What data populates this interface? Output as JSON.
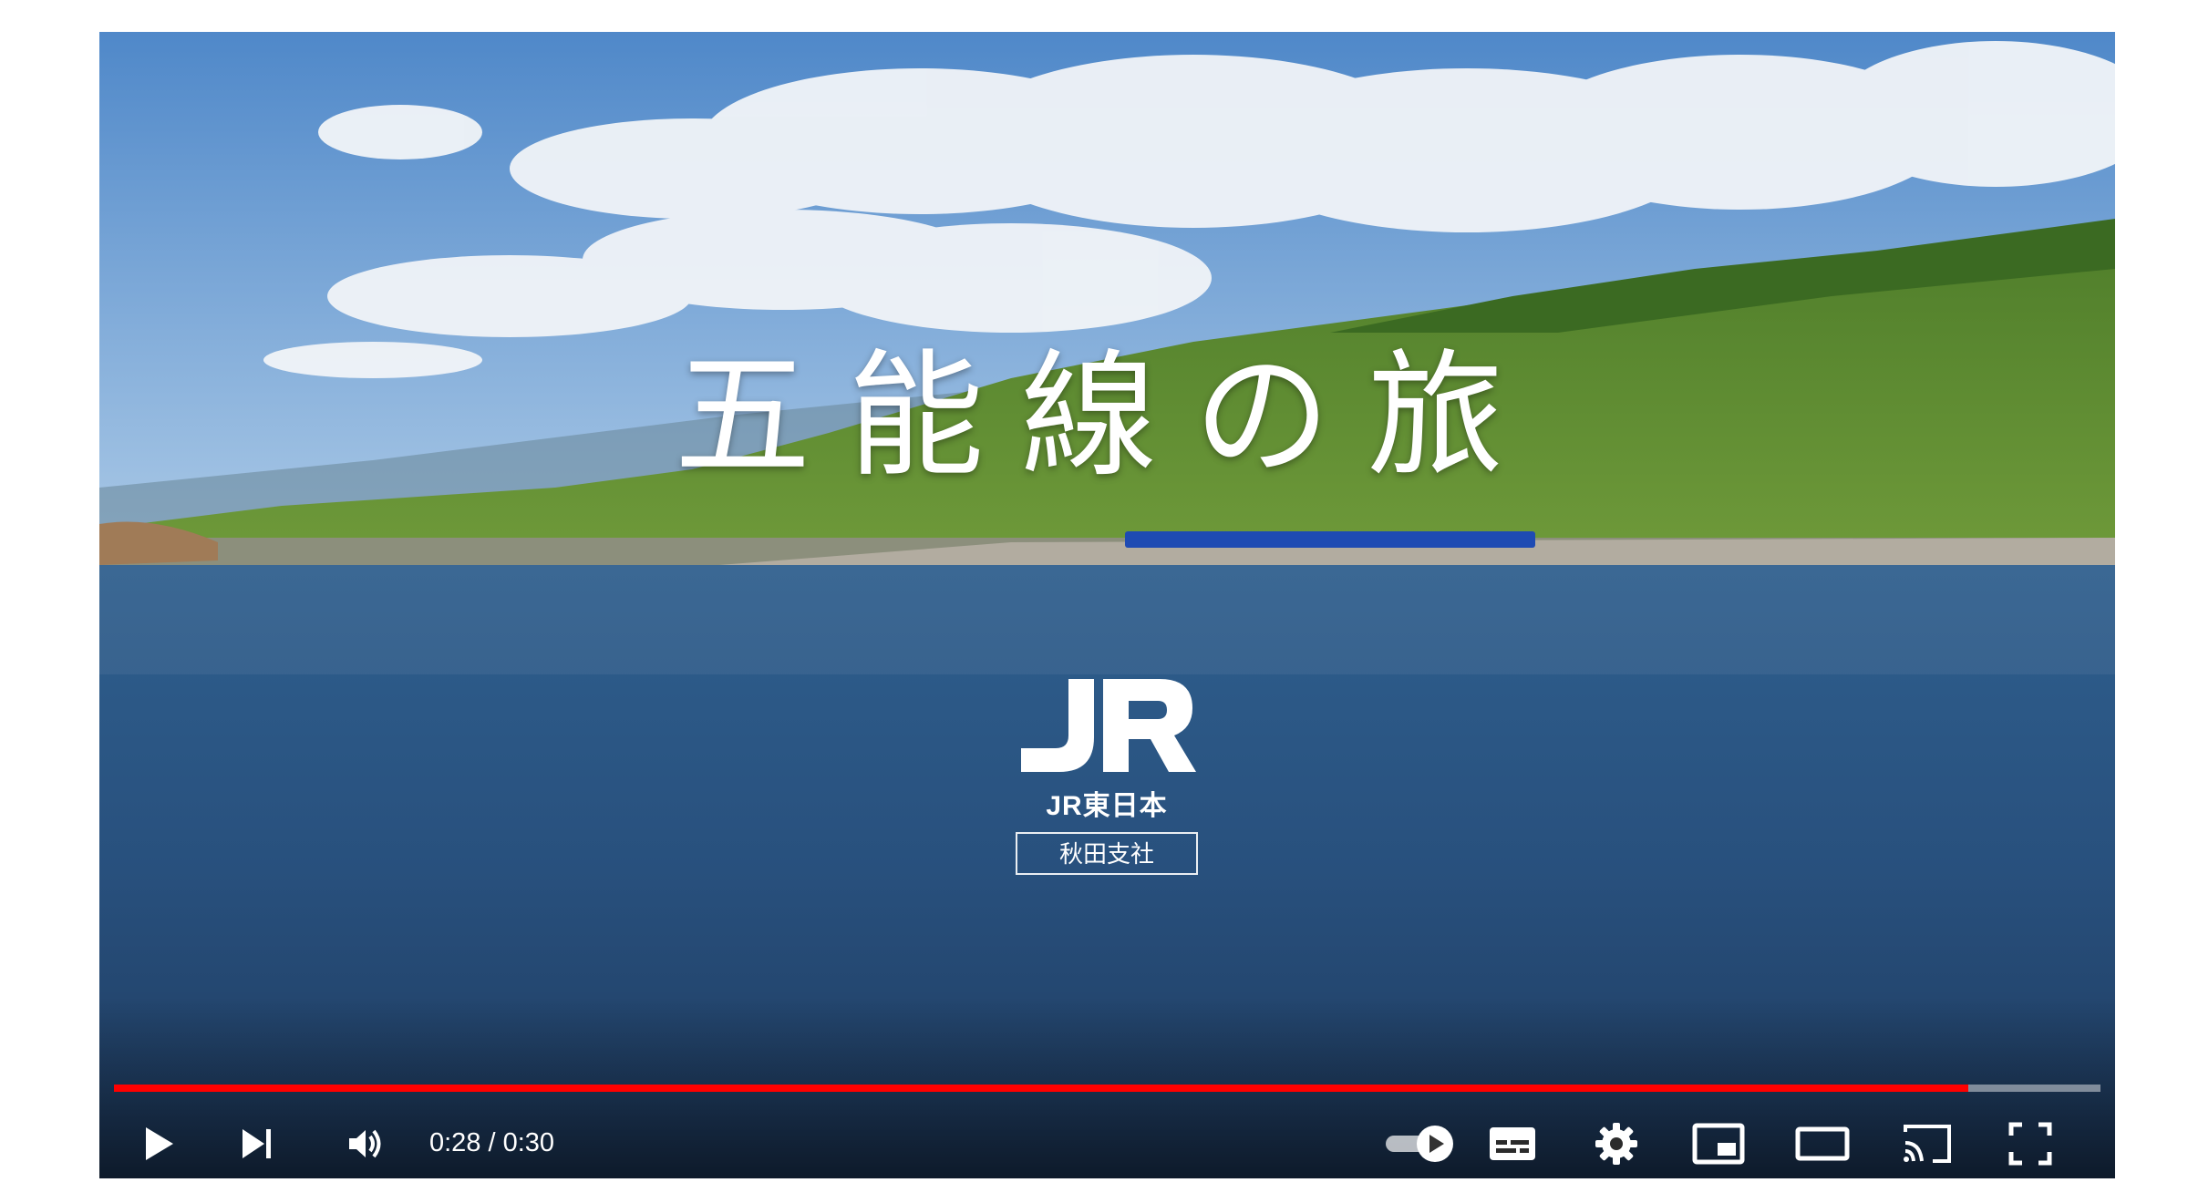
{
  "video": {
    "title_text": "五能線の旅",
    "logo": {
      "mark": "JR",
      "company": "JR東日本",
      "branch": "秋田支社"
    }
  },
  "player": {
    "current_time": "0:28",
    "duration": "0:30",
    "time_display": "0:28 / 0:30",
    "progress": 0.9333,
    "autoplay_enabled": true,
    "progress_color": "#ff0000"
  },
  "controls": {
    "left": [
      "play-icon",
      "next-icon",
      "volume-icon"
    ],
    "right": [
      "autoplay-toggle-icon",
      "subtitles-icon",
      "settings-gear-icon",
      "miniplayer-icon",
      "theater-mode-icon",
      "cast-icon",
      "fullscreen-icon"
    ]
  }
}
